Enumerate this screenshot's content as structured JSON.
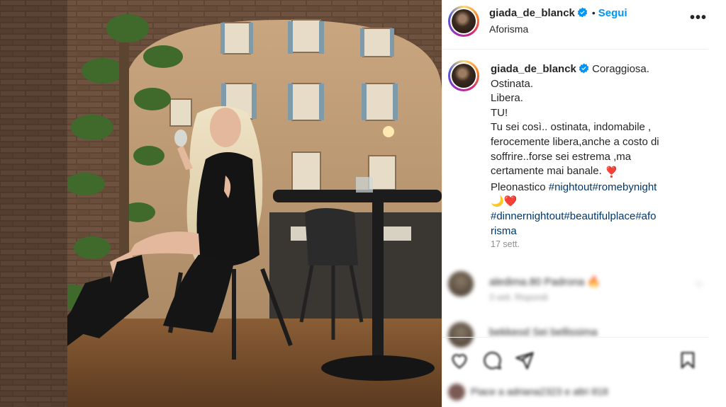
{
  "post": {
    "username": "giada_de_blanck",
    "follow_separator": "•",
    "follow_label": "Segui",
    "subtitle": "Aforisma",
    "more_label": "•••",
    "caption_lines": [
      "Coraggiosa.",
      "Ostinata.",
      "Libera.",
      "TU!",
      "Tu sei così.. ostinata, indomabile ,",
      "ferocemente libera,anche a costo di",
      "soffrire..forse sei estrema ,ma",
      "certamente mai banale."
    ],
    "caption_heart_1": "❣️",
    "pleonastico_word": "Pleonastico",
    "hashtags_line1": "#nightout#romebynight",
    "moon_heart": "🌙❤️",
    "hashtags_line2a": "#dinnernightout#beautifulplace#afo",
    "hashtags_line2b": "risma",
    "timestamp": "17 sett."
  },
  "comments": [
    {
      "text": "aledima.80 Padrona 🔥",
      "meta": "3 sett.   Rispondi"
    },
    {
      "text": "bekkeod Sei bellissima",
      "meta": ""
    }
  ],
  "likes_text": "Piace a adriana2323 e altri 818",
  "icons": {
    "verified": "verified-badge-icon",
    "like": "heart-icon",
    "comment": "comment-icon",
    "share": "paper-plane-icon",
    "save": "bookmark-icon"
  },
  "colors": {
    "link": "#0095f6",
    "hashtag": "#00376b",
    "muted": "#8e8e8e"
  }
}
